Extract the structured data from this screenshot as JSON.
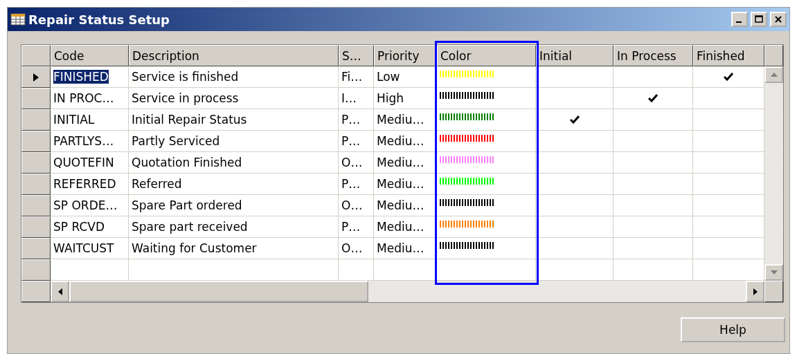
{
  "window": {
    "title": "Repair Status Setup"
  },
  "table": {
    "columns": [
      {
        "label": "Code",
        "highlighted": false
      },
      {
        "label": "Description",
        "highlighted": false
      },
      {
        "label": "S…",
        "highlighted": false
      },
      {
        "label": "Priority",
        "highlighted": false
      },
      {
        "label": "Color",
        "highlighted": true
      },
      {
        "label": "Initial",
        "highlighted": false
      },
      {
        "label": "In Process",
        "highlighted": false
      },
      {
        "label": "Finished",
        "highlighted": false
      }
    ],
    "rows": [
      {
        "selected": true,
        "code": "FINISHED",
        "description": "Service is finished",
        "s": "Fi…",
        "priority": "Low",
        "color": "#ffff00",
        "initial": false,
        "in_process": false,
        "finished": true
      },
      {
        "selected": false,
        "code": "IN PROC…",
        "description": "Service in process",
        "s": "I…",
        "priority": "High",
        "color": "#000000",
        "initial": false,
        "in_process": true,
        "finished": false
      },
      {
        "selected": false,
        "code": "INITIAL",
        "description": "Initial Repair Status",
        "s": "P…",
        "priority": "Mediu…",
        "color": "#008000",
        "initial": true,
        "in_process": false,
        "finished": false
      },
      {
        "selected": false,
        "code": "PARTLYS…",
        "description": "Partly Serviced",
        "s": "P…",
        "priority": "Mediu…",
        "color": "#ff0000",
        "initial": false,
        "in_process": false,
        "finished": false
      },
      {
        "selected": false,
        "code": "QUOTEFIN",
        "description": "Quotation Finished",
        "s": "O…",
        "priority": "Mediu…",
        "color": "#ff80ff",
        "initial": false,
        "in_process": false,
        "finished": false
      },
      {
        "selected": false,
        "code": "REFERRED",
        "description": "Referred",
        "s": "P…",
        "priority": "Mediu…",
        "color": "#00ff00",
        "initial": false,
        "in_process": false,
        "finished": false
      },
      {
        "selected": false,
        "code": "SP ORDE…",
        "description": "Spare Part ordered",
        "s": "O…",
        "priority": "Mediu…",
        "color": "#000000",
        "initial": false,
        "in_process": false,
        "finished": false
      },
      {
        "selected": false,
        "code": "SP RCVD",
        "description": "Spare part received",
        "s": "P…",
        "priority": "Mediu…",
        "color": "#ff8000",
        "initial": false,
        "in_process": false,
        "finished": false
      },
      {
        "selected": false,
        "code": "WAITCUST",
        "description": "Waiting for Customer",
        "s": "O…",
        "priority": "Mediu…",
        "color": "#000000",
        "initial": false,
        "in_process": false,
        "finished": false
      }
    ]
  },
  "buttons": [
    {
      "label": "Help"
    }
  ]
}
